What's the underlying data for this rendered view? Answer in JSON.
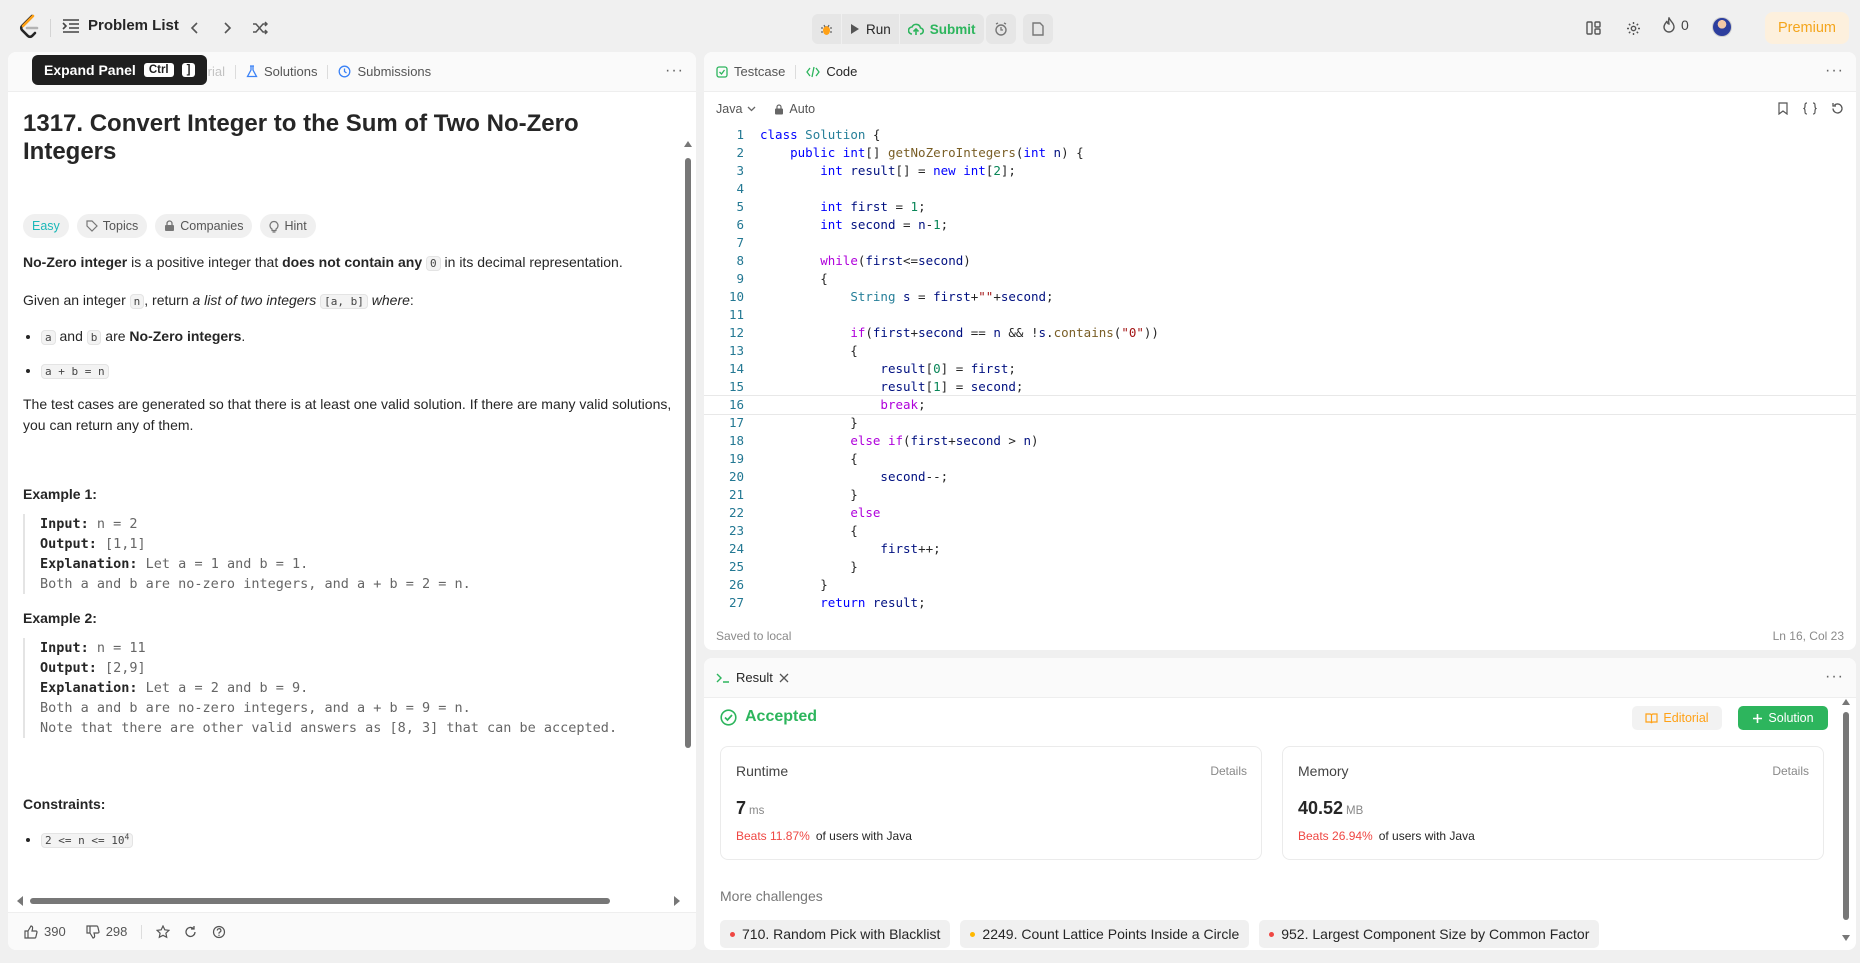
{
  "topbar": {
    "problem_list": "Problem List",
    "run": "Run",
    "submit": "Submit",
    "streak": "0",
    "premium": "Premium"
  },
  "tooltip": {
    "label": "Expand Panel",
    "key1": "Ctrl",
    "key2": "]"
  },
  "desc_tabs": {
    "editorial": "Editorial",
    "solutions": "Solutions",
    "submissions": "Submissions"
  },
  "problem": {
    "title": "1317. Convert Integer to the Sum of Two No-Zero Integers",
    "difficulty": "Easy",
    "tags": [
      "Topics",
      "Companies",
      "Hint"
    ],
    "p1_bold1": "No-Zero integer",
    "p1_t1": " is a positive integer that ",
    "p1_bold2": "does not contain any",
    "p1_code": "0",
    "p1_t2": " in its decimal representation.",
    "p2_t1": "Given an integer ",
    "p2_code1": "n",
    "p2_t2": ", return ",
    "p2_em": "a list of two integers",
    "p2_code2": "[a, b]",
    "p2_em2": "where",
    "p2_t3": ":",
    "b1_code1": "a",
    "b1_and": " and ",
    "b1_code2": "b",
    "b1_are": " are ",
    "b1_bold": "No-Zero integers",
    "b1_end": ".",
    "b2_code": "a + b = n",
    "p3": "The test cases are generated so that there is at least one valid solution. If there are many valid solutions, you can return any of them.",
    "ex1_h": "Example 1:",
    "ex1_input_l": "Input:",
    "ex1_input": " n = 2",
    "ex1_output_l": "Output:",
    "ex1_output": " [1,1]",
    "ex1_expl_l": "Explanation:",
    "ex1_expl": " Let a = 1 and b = 1.",
    "ex1_expl2": "Both a and b are no-zero integers, and a + b = 2 = n.",
    "ex2_h": "Example 2:",
    "ex2_input_l": "Input:",
    "ex2_input": " n = 11",
    "ex2_output_l": "Output:",
    "ex2_output": " [2,9]",
    "ex2_expl_l": "Explanation:",
    "ex2_expl": " Let a = 2 and b = 9.",
    "ex2_expl2": "Both a and b are no-zero integers, and a + b = 9 = n.",
    "ex2_expl3": "Note that there are other valid answers as [8, 3] that can be accepted.",
    "constraints_h": "Constraints:",
    "constraint1": "2 <= n <= 10",
    "constraint1_sup": "4"
  },
  "footer": {
    "likes": "390",
    "dislikes": "298"
  },
  "code_panel": {
    "tab_testcase": "Testcase",
    "tab_code": "Code",
    "language": "Java",
    "auto": "Auto",
    "saved": "Saved to local",
    "cursor": "Ln 16, Col 23"
  },
  "code_lines": [
    "class Solution {",
    "    public int[] getNoZeroIntegers(int n) {",
    "        int result[] = new int[2];",
    "",
    "        int first = 1;",
    "        int second = n-1;",
    "",
    "        while(first<=second)",
    "        {",
    "            String s = first+\"\"+second;",
    "",
    "            if(first+second == n && !s.contains(\"0\"))",
    "            {",
    "                result[0] = first;",
    "                result[1] = second;",
    "                break;",
    "            }",
    "            else if(first+second > n)",
    "            {",
    "                second--;",
    "            }",
    "            else",
    "            {",
    "                first++;",
    "            }",
    "        }",
    "        return result;"
  ],
  "result": {
    "tab": "Result",
    "status": "Accepted",
    "editorial_btn": "Editorial",
    "solution_btn": "Solution",
    "runtime": {
      "label": "Runtime",
      "details": "Details",
      "value": "7",
      "unit": "ms",
      "beats": "Beats 11.87%",
      "suffix": "of users with Java"
    },
    "memory": {
      "label": "Memory",
      "details": "Details",
      "value": "40.52",
      "unit": "MB",
      "beats": "Beats 26.94%",
      "suffix": "of users with Java"
    },
    "more": "More challenges",
    "challenges": [
      {
        "title": "710. Random Pick with Blacklist",
        "color": "#ef4743"
      },
      {
        "title": "2249. Count Lattice Points Inside a Circle",
        "color": "#ffb800"
      },
      {
        "title": "952. Largest Component Size by Common Factor",
        "color": "#ef4743"
      }
    ]
  }
}
